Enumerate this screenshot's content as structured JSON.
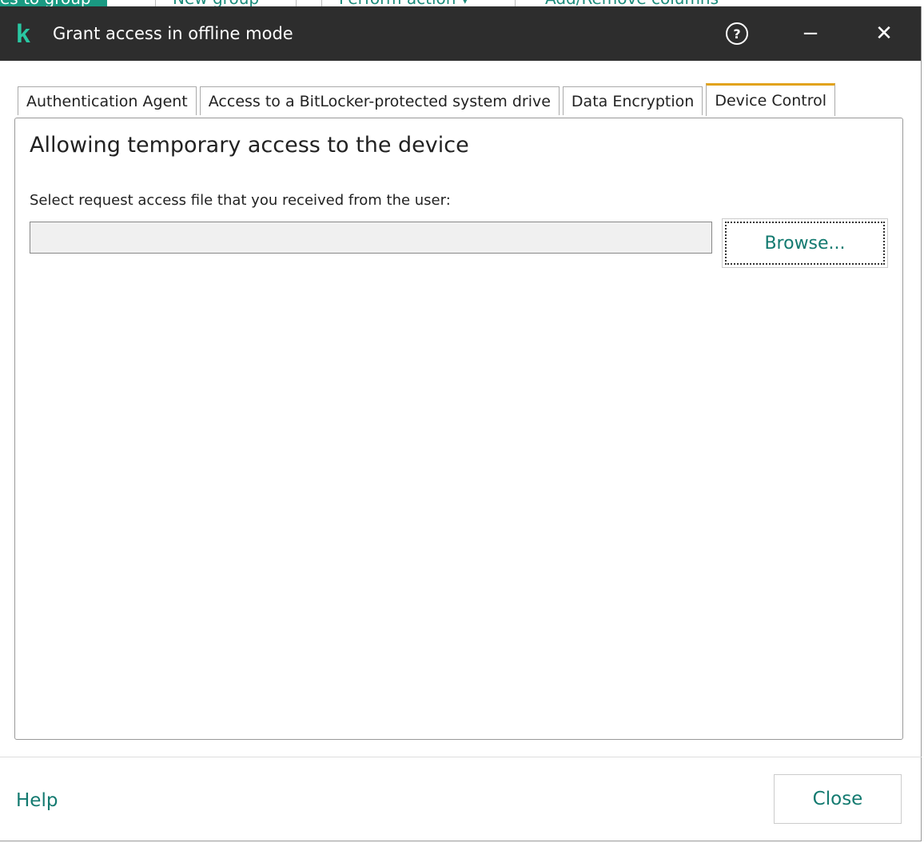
{
  "background_toolbar": {
    "items": [
      "es to group",
      "New group",
      "Perform action ▾",
      "Add/Remove columns"
    ]
  },
  "dialog": {
    "title": "Grant access in offline mode",
    "logo": "k",
    "help_icon": "?",
    "minimize_icon": "−",
    "close_icon": "✕",
    "tabs": [
      {
        "label": "Authentication Agent",
        "active": false
      },
      {
        "label": "Access to a BitLocker-protected system drive",
        "active": false
      },
      {
        "label": "Data Encryption",
        "active": false
      },
      {
        "label": "Device Control",
        "active": true
      }
    ],
    "heading": "Allowing temporary access to the device",
    "file_label": "Select request access file that you received from the user:",
    "file_value": "",
    "browse_label": "Browse...",
    "help_link": "Help",
    "close_label": "Close"
  },
  "colors": {
    "accent": "#137a70",
    "titlebar": "#2d2d2d",
    "tab_active": "#e2a31c",
    "logo": "#29c7a2"
  }
}
